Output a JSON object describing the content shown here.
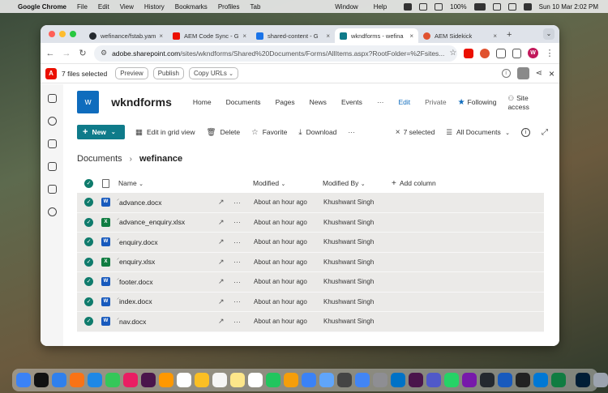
{
  "menubar": {
    "app": "Google Chrome",
    "items": [
      "File",
      "Edit",
      "View",
      "History",
      "Bookmarks",
      "Profiles",
      "Tab"
    ],
    "right_items": [
      "Window",
      "Help"
    ],
    "battery": "100%",
    "clock": "Sun 10 Mar  2:02 PM"
  },
  "browser": {
    "tabs": [
      {
        "label": "wefinance/fstab.yam",
        "favicon_color": "#24292f"
      },
      {
        "label": "AEM Code Sync - G",
        "favicon_color": "#eb1000"
      },
      {
        "label": "shared-content - G",
        "favicon_color": "#1a73e8"
      },
      {
        "label": "wkndforms - wefina",
        "favicon_color": "#0f7b8a"
      },
      {
        "label": "AEM Sidekick",
        "favicon_color": "#e0522f"
      }
    ],
    "url_host": "adobe.sharepoint.com",
    "url_path": "/sites/wkndforms/Shared%20Documents/Forms/AllItems.aspx?RootFolder=%2Fsites...",
    "profile_initial": "W"
  },
  "sidekick": {
    "selection_text": "7 files selected",
    "preview_label": "Preview",
    "publish_label": "Publish",
    "copy_urls_label": "Copy URLs"
  },
  "site": {
    "logo_letter": "w",
    "title": "wkndforms",
    "nav": [
      "Home",
      "Documents",
      "Pages",
      "News",
      "Events"
    ],
    "nav_more": "···",
    "edit_label": "Edit",
    "privacy": "Private",
    "following_label": "Following",
    "site_access_label": "Site access"
  },
  "commands": {
    "new_label": "New",
    "edit_grid_label": "Edit in grid view",
    "delete_label": "Delete",
    "favorite_label": "Favorite",
    "download_label": "Download",
    "more": "···",
    "selected_label": "7 selected",
    "view_label": "All Documents"
  },
  "breadcrumb": {
    "root": "Documents",
    "current": "wefinance"
  },
  "grid": {
    "columns": {
      "name": "Name",
      "modified": "Modified",
      "modified_by": "Modified By",
      "add_column": "Add column"
    },
    "rows": [
      {
        "name": "advance.docx",
        "type": "docx",
        "modified": "About an hour ago",
        "modified_by": "Khushwant Singh"
      },
      {
        "name": "advance_enquiry.xlsx",
        "type": "xlsx",
        "modified": "About an hour ago",
        "modified_by": "Khushwant Singh"
      },
      {
        "name": "enquiry.docx",
        "type": "docx",
        "modified": "About an hour ago",
        "modified_by": "Khushwant Singh"
      },
      {
        "name": "enquiry.xlsx",
        "type": "xlsx",
        "modified": "About an hour ago",
        "modified_by": "Khushwant Singh"
      },
      {
        "name": "footer.docx",
        "type": "docx",
        "modified": "About an hour ago",
        "modified_by": "Khushwant Singh"
      },
      {
        "name": "index.docx",
        "type": "docx",
        "modified": "About an hour ago",
        "modified_by": "Khushwant Singh"
      },
      {
        "name": "nav.docx",
        "type": "docx",
        "modified": "About an hour ago",
        "modified_by": "Khushwant Singh"
      }
    ]
  },
  "dock": {
    "apps": [
      "finder-icon",
      "tv-icon",
      "safari-icon",
      "firefox-icon",
      "app-store-icon",
      "messages-icon",
      "photos-icon",
      "slack-icon",
      "photos-icon",
      "calendar-icon",
      "notes-icon",
      "reminders-icon",
      "notes-icon",
      "freeform-icon",
      "numbers-icon",
      "pages-icon",
      "keynote-icon",
      "preview-icon",
      "quicktime-icon",
      "chrome-icon",
      "system-settings-icon",
      "outlook-icon",
      "slack-icon",
      "teams-icon",
      "whatsapp-icon",
      "onenote-icon",
      "github-icon",
      "word-icon",
      "terminal-icon",
      "vscode-icon",
      "excel-icon",
      "photoshop-icon",
      "downloads-icon",
      "trash-icon"
    ],
    "app_colors": [
      "#3b82f6",
      "#111111",
      "#2f80ed",
      "#f97316",
      "#1e88e5",
      "#34c759",
      "#e91e63",
      "#4a154b",
      "#ff9800",
      "#ffffff",
      "#fbbf24",
      "#f5f5f5",
      "#fde68a",
      "#ffffff",
      "#22c55e",
      "#f59e0b",
      "#3b82f6",
      "#60a5fa",
      "#444444",
      "#4285f4",
      "#8e8e93",
      "#0072c6",
      "#4a154b",
      "#5059c9",
      "#25d366",
      "#7719aa",
      "#24292f",
      "#185abd",
      "#222222",
      "#0078d4",
      "#107c41",
      "#001e36",
      "#9ca3af",
      "#d1d5db"
    ]
  }
}
